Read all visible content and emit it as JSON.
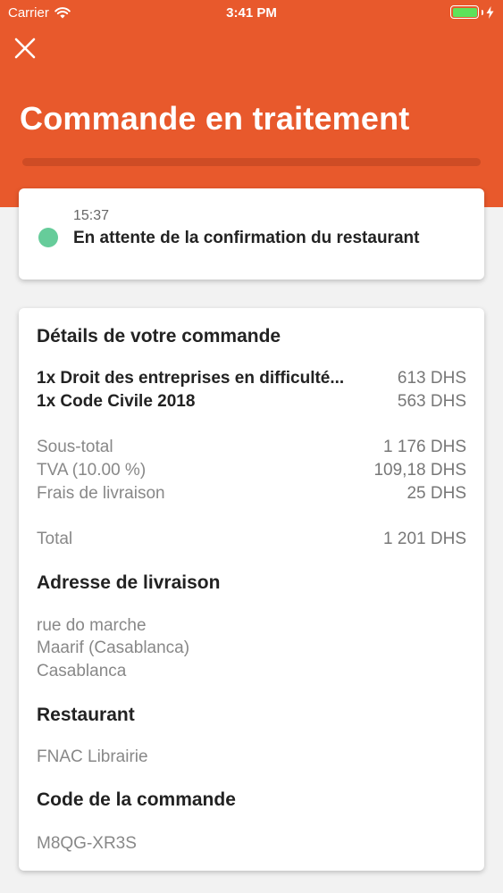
{
  "status_bar": {
    "carrier": "Carrier",
    "time": "3:41 PM",
    "battery_level": 1.0
  },
  "header": {
    "title": "Commande en traitement",
    "color": "#e8592c"
  },
  "status": {
    "time": "15:37",
    "text": "En attente de la confirmation du restaurant",
    "dot_color": "#66cc9a"
  },
  "details": {
    "title": "Détails de votre commande",
    "items": [
      {
        "name": "1x Droit des entreprises en difficulté...",
        "price": "613 DHS"
      },
      {
        "name": "1x Code Civile 2018",
        "price": "563 DHS"
      }
    ],
    "subtotal_label": "Sous-total",
    "subtotal": "1 176 DHS",
    "tva_label": "TVA (10.00 %)",
    "tva": "109,18 DHS",
    "delivery_label": "Frais de livraison",
    "delivery": "25 DHS",
    "total_label": "Total",
    "total": "1 201 DHS"
  },
  "address": {
    "title": "Adresse de livraison",
    "lines": [
      "rue do marche",
      "Maarif (Casablanca)",
      "Casablanca"
    ]
  },
  "restaurant": {
    "title": "Restaurant",
    "name": "FNAC Librairie"
  },
  "order_code": {
    "title": "Code de la commande",
    "code": "M8QG-XR3S"
  }
}
